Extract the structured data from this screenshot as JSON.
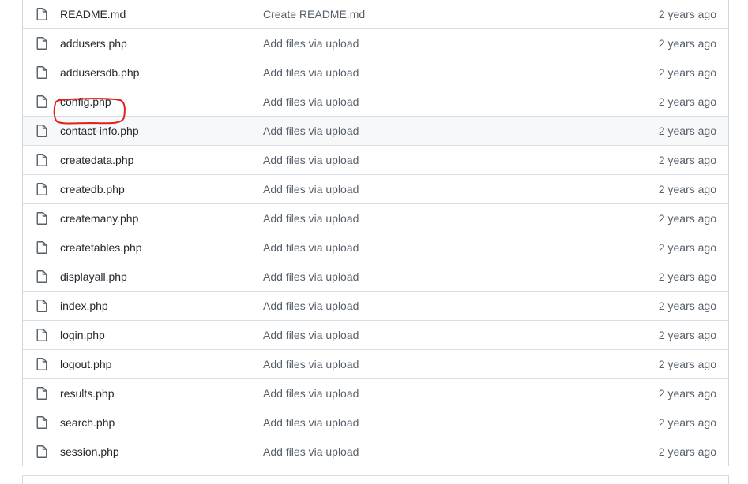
{
  "files": [
    {
      "name": "README.md",
      "message": "Create README.md",
      "age": "2 years ago",
      "icon": "file-icon"
    },
    {
      "name": "addusers.php",
      "message": "Add files via upload",
      "age": "2 years ago",
      "icon": "file-icon"
    },
    {
      "name": "addusersdb.php",
      "message": "Add files via upload",
      "age": "2 years ago",
      "icon": "file-icon"
    },
    {
      "name": "config.php",
      "message": "Add files via upload",
      "age": "2 years ago",
      "icon": "file-icon"
    },
    {
      "name": "contact-info.php",
      "message": "Add files via upload",
      "age": "2 years ago",
      "icon": "file-icon"
    },
    {
      "name": "createdata.php",
      "message": "Add files via upload",
      "age": "2 years ago",
      "icon": "file-icon"
    },
    {
      "name": "createdb.php",
      "message": "Add files via upload",
      "age": "2 years ago",
      "icon": "file-icon"
    },
    {
      "name": "createmany.php",
      "message": "Add files via upload",
      "age": "2 years ago",
      "icon": "file-icon"
    },
    {
      "name": "createtables.php",
      "message": "Add files via upload",
      "age": "2 years ago",
      "icon": "file-icon"
    },
    {
      "name": "displayall.php",
      "message": "Add files via upload",
      "age": "2 years ago",
      "icon": "file-icon"
    },
    {
      "name": "index.php",
      "message": "Add files via upload",
      "age": "2 years ago",
      "icon": "file-icon"
    },
    {
      "name": "login.php",
      "message": "Add files via upload",
      "age": "2 years ago",
      "icon": "file-icon"
    },
    {
      "name": "logout.php",
      "message": "Add files via upload",
      "age": "2 years ago",
      "icon": "file-icon"
    },
    {
      "name": "results.php",
      "message": "Add files via upload",
      "age": "2 years ago",
      "icon": "file-icon"
    },
    {
      "name": "search.php",
      "message": "Add files via upload",
      "age": "2 years ago",
      "icon": "file-icon"
    },
    {
      "name": "session.php",
      "message": "Add files via upload",
      "age": "2 years ago",
      "icon": "file-icon"
    }
  ],
  "hovered_row": "contact-info.php",
  "annotation": {
    "target": "config.php",
    "color": "#e0201c"
  }
}
